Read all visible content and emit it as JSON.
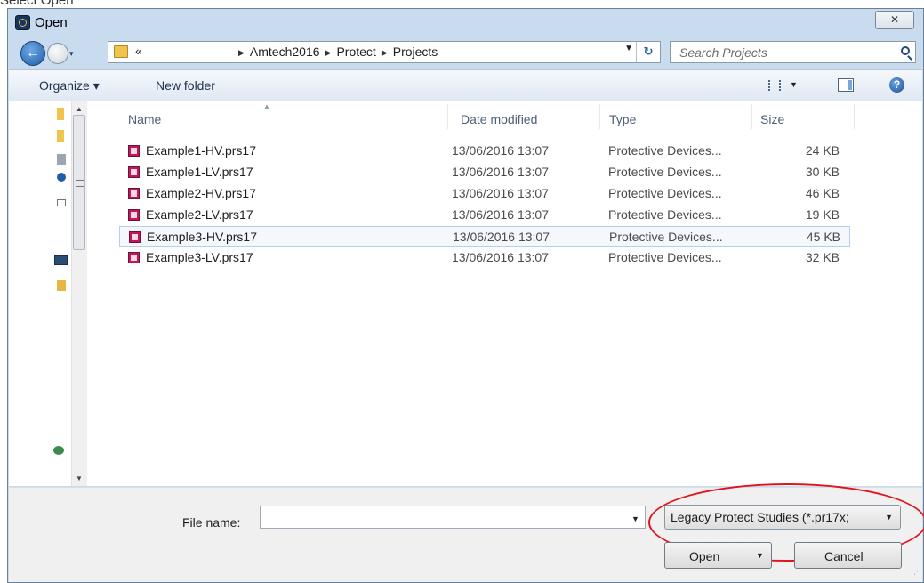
{
  "cutoff_text": "Select Open",
  "window": {
    "title": "Open",
    "close_glyph": "✕"
  },
  "nav": {
    "back_glyph": "←",
    "history_glyph": "▾",
    "overflow": "«",
    "refresh_glyph": "↻"
  },
  "breadcrumb": [
    "Amtech2016",
    "Protect",
    "Projects"
  ],
  "search": {
    "placeholder": "Search Projects"
  },
  "toolbar": {
    "organize": "Organize ▾",
    "new_folder": "New folder"
  },
  "columns": {
    "name": "Name",
    "date": "Date modified",
    "type": "Type",
    "size": "Size"
  },
  "files": [
    {
      "name": "Example1-HV.prs17",
      "date": "13/06/2016 13:07",
      "type": "Protective Devices...",
      "size": "24 KB"
    },
    {
      "name": "Example1-LV.prs17",
      "date": "13/06/2016 13:07",
      "type": "Protective Devices...",
      "size": "30 KB"
    },
    {
      "name": "Example2-HV.prs17",
      "date": "13/06/2016 13:07",
      "type": "Protective Devices...",
      "size": "46 KB"
    },
    {
      "name": "Example2-LV.prs17",
      "date": "13/06/2016 13:07",
      "type": "Protective Devices...",
      "size": "19 KB"
    },
    {
      "name": "Example3-HV.prs17",
      "date": "13/06/2016 13:07",
      "type": "Protective Devices...",
      "size": "45 KB"
    },
    {
      "name": "Example3-LV.prs17",
      "date": "13/06/2016 13:07",
      "type": "Protective Devices...",
      "size": "32 KB"
    }
  ],
  "selected_index": 4,
  "bottom": {
    "file_name_label": "File name:",
    "file_name_value": "",
    "filter": "Legacy Protect Studies (*.pr17x;",
    "open_label": "Open",
    "cancel_label": "Cancel"
  },
  "colors": {
    "highlight_oval": "#e0141c",
    "file_icon": "#c2185b",
    "window_frame": "#c9dbee"
  }
}
